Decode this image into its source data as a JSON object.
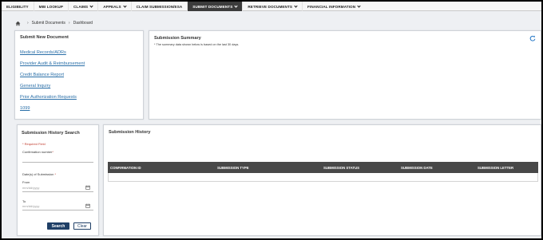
{
  "nav": {
    "items": [
      {
        "label": "ELIGIBILITY",
        "dropdown": false,
        "active": false
      },
      {
        "label": "MBI LOOKUP",
        "dropdown": false,
        "active": false
      },
      {
        "label": "CLAIMS",
        "dropdown": true,
        "active": false
      },
      {
        "label": "APPEALS",
        "dropdown": true,
        "active": false
      },
      {
        "label": "CLAIM SUBMISSION/ESA",
        "dropdown": false,
        "active": false
      },
      {
        "label": "SUBMIT DOCUMENTS",
        "dropdown": true,
        "active": true
      },
      {
        "label": "RETRIEVE DOCUMENTS",
        "dropdown": true,
        "active": false
      },
      {
        "label": "FINANCIAL INFORMATION",
        "dropdown": true,
        "active": false
      }
    ]
  },
  "breadcrumb": {
    "items": [
      "Submit Documents",
      "Dashboard"
    ]
  },
  "submit_new": {
    "title": "Submit New Document",
    "links": [
      "Medical Records/ADRs",
      "Provider Audit & Reimbursement",
      "Credit Balance Report",
      "General Inquiry",
      "Prior Authorization Requests",
      "1099"
    ]
  },
  "summary": {
    "title": "Submission Summary",
    "note": "* The summary data shown below is based on the last 30 days."
  },
  "search": {
    "title": "Submission History Search",
    "required_note": "* Required Field",
    "confirmation_label": "Confirmation number",
    "required_mark": "*",
    "dates_label": "Date(s) of Submission",
    "from_label": "From",
    "from_placeholder": "mm/dd/yyyy",
    "to_label": "To",
    "to_placeholder": "mm/dd/yyyy",
    "search_button": "Search",
    "clear_button": "Clear"
  },
  "history": {
    "title": "Submission History",
    "columns": [
      "CONFIRMATION ID",
      "SUBMISSION TYPE",
      "SUBMISSION STATUS",
      "SUBMISSION DATE",
      "SUBMISSION LETTER"
    ],
    "rows": []
  },
  "colors": {
    "link": "#2a6fa8",
    "nav_active": "#3c3c3c",
    "table_header": "#484848",
    "primary_button": "#1f3f66",
    "required": "#c0392b"
  }
}
